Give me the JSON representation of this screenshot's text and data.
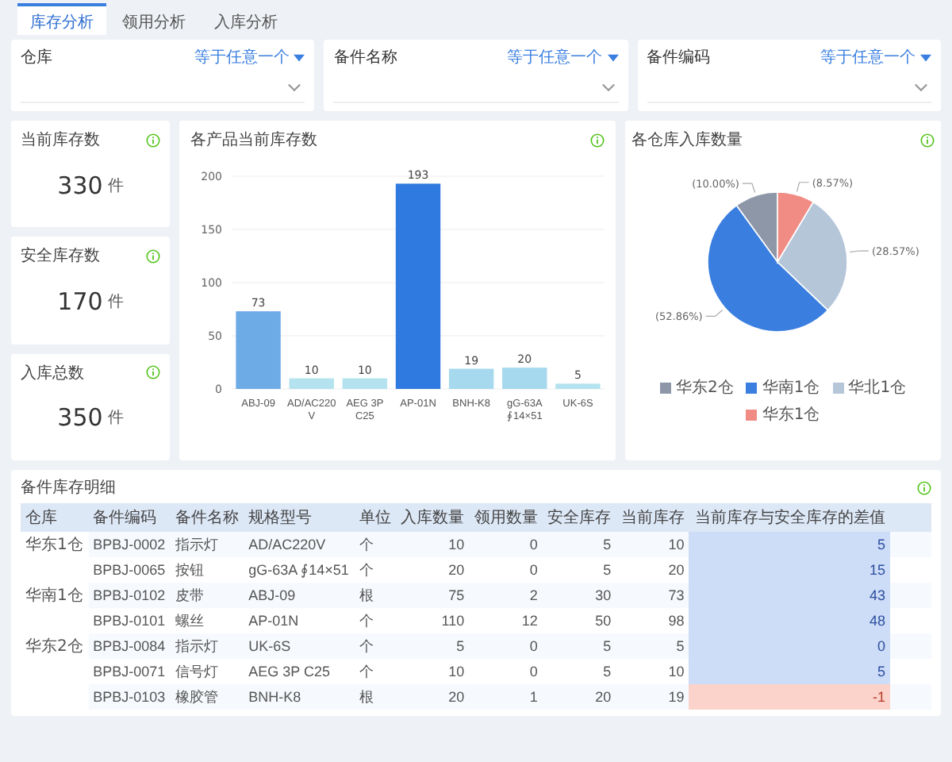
{
  "tabs": [
    {
      "label": "库存分析",
      "selected": true
    },
    {
      "label": "领用分析",
      "selected": false
    },
    {
      "label": "入库分析",
      "selected": false
    }
  ],
  "filters": [
    {
      "label": "仓库",
      "operator": "等于任意一个"
    },
    {
      "label": "备件名称",
      "operator": "等于任意一个"
    },
    {
      "label": "备件编码",
      "operator": "等于任意一个"
    }
  ],
  "stats": [
    {
      "title": "当前库存数",
      "value": "330",
      "unit": "件"
    },
    {
      "title": "安全库存数",
      "value": "170",
      "unit": "件"
    },
    {
      "title": "入库总数",
      "value": "350",
      "unit": "件"
    }
  ],
  "bar_card": {
    "chart_data": {
      "type": "bar",
      "title": "各产品当前库存数",
      "categories": [
        "ABJ-09",
        "AD/AC220V",
        "AEG 3P C25",
        "AP-01N",
        "BNH-K8",
        "gG-63A ∮14×51",
        "UK-6S"
      ],
      "series": [
        {
          "values": [
            73,
            10,
            10,
            193,
            19,
            20,
            5
          ]
        }
      ],
      "ylim": [
        0,
        200
      ],
      "yticks": [
        0,
        50,
        100,
        150,
        200
      ],
      "grid": true,
      "data_labels": true
    },
    "bars": [
      {
        "color": "#6dabe7"
      },
      {
        "color": "#b4e3ef"
      },
      {
        "color": "#b4e3ef"
      },
      {
        "color": "#2f7ae0"
      },
      {
        "color": "#a6d8ee"
      },
      {
        "color": "#a6d8ee"
      },
      {
        "color": "#b4e3ef"
      }
    ]
  },
  "pie_card": {
    "chart_data": {
      "type": "pie",
      "title": "各仓库入库数量",
      "categories": [
        "华东2仓",
        "华南1仓",
        "华北1仓",
        "华东1仓"
      ],
      "values": [
        10.0,
        52.86,
        28.57,
        8.57
      ],
      "colors": [
        "#8e97a8",
        "#3a7fe0",
        "#b5c6d9",
        "#f08c84"
      ],
      "value_labels": [
        "(10.00%)",
        "(52.86%)",
        "(28.57%)",
        "(8.57%)"
      ],
      "legend": "bottom"
    }
  },
  "table": {
    "title": "备件库存明细",
    "columns": [
      "仓库",
      "备件编码",
      "备件名称",
      "规格型号",
      "单位",
      "入库数量",
      "领用数量",
      "安全库存",
      "当前库存",
      "当前库存与安全库存的差值"
    ],
    "groups": [
      {
        "warehouse": "华东1仓",
        "rows": [
          {
            "code": "BPBJ-0002",
            "name": "指示灯",
            "spec": "AD/AC220V",
            "unit": "个",
            "in": "10",
            "out": "0",
            "safety": "5",
            "current": "10",
            "diff": "5",
            "alert": false
          },
          {
            "code": "BPBJ-0065",
            "name": "按钮",
            "spec": "gG-63A ∮14×51",
            "unit": "个",
            "in": "20",
            "out": "0",
            "safety": "5",
            "current": "20",
            "diff": "15",
            "alert": false
          }
        ]
      },
      {
        "warehouse": "华南1仓",
        "rows": [
          {
            "code": "BPBJ-0102",
            "name": "皮带",
            "spec": "ABJ-09",
            "unit": "根",
            "in": "75",
            "out": "2",
            "safety": "30",
            "current": "73",
            "diff": "43",
            "alert": false
          },
          {
            "code": "BPBJ-0101",
            "name": "螺丝",
            "spec": "AP-01N",
            "unit": "个",
            "in": "110",
            "out": "12",
            "safety": "50",
            "current": "98",
            "diff": "48",
            "alert": false
          }
        ]
      },
      {
        "warehouse": "华东2仓",
        "rows": [
          {
            "code": "BPBJ-0084",
            "name": "指示灯",
            "spec": "UK-6S",
            "unit": "个",
            "in": "5",
            "out": "0",
            "safety": "5",
            "current": "5",
            "diff": "0",
            "alert": false
          },
          {
            "code": "BPBJ-0071",
            "name": "信号灯",
            "spec": "AEG 3P C25",
            "unit": "个",
            "in": "10",
            "out": "0",
            "safety": "5",
            "current": "10",
            "diff": "5",
            "alert": false
          },
          {
            "code": "BPBJ-0103",
            "name": "橡胶管",
            "spec": "BNH-K8",
            "unit": "根",
            "in": "20",
            "out": "1",
            "safety": "20",
            "current": "19",
            "diff": "-1",
            "alert": true
          }
        ]
      }
    ]
  }
}
